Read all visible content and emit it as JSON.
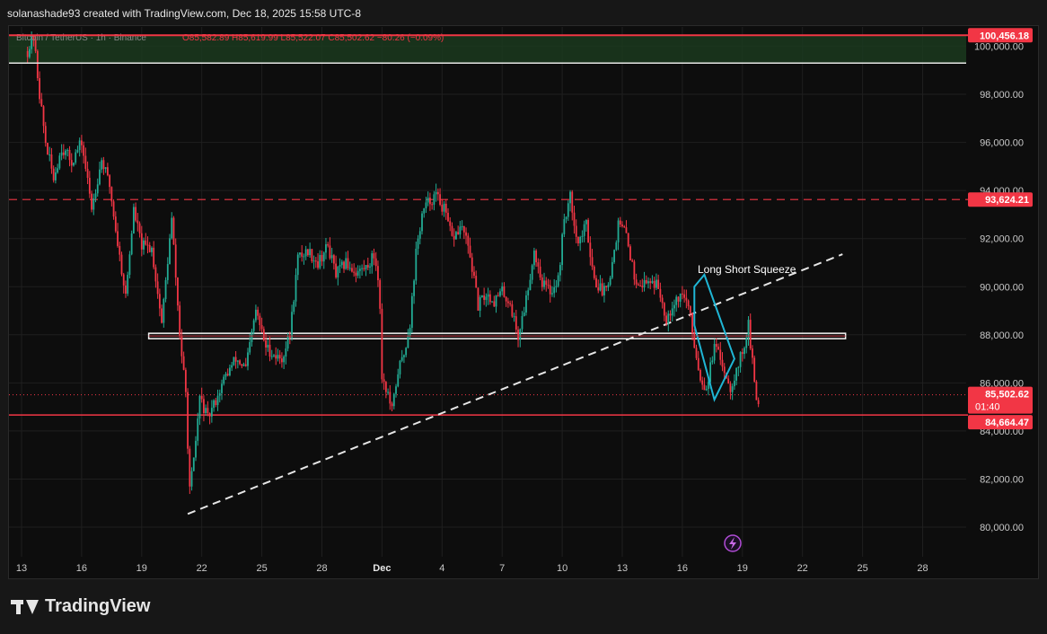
{
  "header": {
    "created_by": "solanashade93 created with TradingView.com, Dec 18, 2025 15:58 UTC-8"
  },
  "legend": {
    "symbol": "Bitcoin / TetherUS · 1h · Binance",
    "ohlc": "O85,582.89 H85,619.99 L85,522.07 C85,502.62 −80.26 (−0.09%)"
  },
  "footer": {
    "brand": "TradingView"
  },
  "chart_data": {
    "type": "candlestick",
    "x_ticks": [
      "13",
      "16",
      "19",
      "22",
      "25",
      "28",
      "Dec",
      "4",
      "7",
      "10",
      "13",
      "16",
      "19",
      "22",
      "25",
      "28"
    ],
    "y_ticks": [
      "80,000.00",
      "82,000.00",
      "84,000.00",
      "86,000.00",
      "88,000.00",
      "90,000.00",
      "92,000.00",
      "94,000.00",
      "96,000.00",
      "98,000.00",
      "100,000.00"
    ],
    "ylim": [
      79000,
      100600
    ],
    "grid": true,
    "price_path": [
      {
        "d": 13.3,
        "p": 99800
      },
      {
        "d": 13.6,
        "p": 100400
      },
      {
        "d": 13.9,
        "p": 98000
      },
      {
        "d": 14.2,
        "p": 96000
      },
      {
        "d": 14.6,
        "p": 94500
      },
      {
        "d": 15.0,
        "p": 95800
      },
      {
        "d": 15.5,
        "p": 95200
      },
      {
        "d": 16.0,
        "p": 96000
      },
      {
        "d": 16.5,
        "p": 93300
      },
      {
        "d": 17.0,
        "p": 95300
      },
      {
        "d": 17.4,
        "p": 94200
      },
      {
        "d": 17.8,
        "p": 91800
      },
      {
        "d": 18.2,
        "p": 89600
      },
      {
        "d": 18.6,
        "p": 93200
      },
      {
        "d": 19.0,
        "p": 91700
      },
      {
        "d": 19.5,
        "p": 91600
      },
      {
        "d": 20.0,
        "p": 88500
      },
      {
        "d": 20.5,
        "p": 92800
      },
      {
        "d": 20.9,
        "p": 88000
      },
      {
        "d": 21.2,
        "p": 85500
      },
      {
        "d": 21.4,
        "p": 81500
      },
      {
        "d": 21.6,
        "p": 82700
      },
      {
        "d": 21.9,
        "p": 85400
      },
      {
        "d": 22.3,
        "p": 84500
      },
      {
        "d": 22.7,
        "p": 85300
      },
      {
        "d": 23.2,
        "p": 86300
      },
      {
        "d": 23.7,
        "p": 87000
      },
      {
        "d": 24.2,
        "p": 86600
      },
      {
        "d": 24.7,
        "p": 89000
      },
      {
        "d": 25.2,
        "p": 87500
      },
      {
        "d": 25.7,
        "p": 87100
      },
      {
        "d": 26.0,
        "p": 87000
      },
      {
        "d": 26.4,
        "p": 88000
      },
      {
        "d": 26.8,
        "p": 91200
      },
      {
        "d": 27.3,
        "p": 91500
      },
      {
        "d": 27.8,
        "p": 91000
      },
      {
        "d": 28.3,
        "p": 91700
      },
      {
        "d": 28.7,
        "p": 90500
      },
      {
        "d": 29.2,
        "p": 91000
      },
      {
        "d": 29.7,
        "p": 90600
      },
      {
        "d": 30.2,
        "p": 90800
      },
      {
        "d": 30.6,
        "p": 91300
      },
      {
        "d": 30.85,
        "p": 90300
      },
      {
        "d": 31.0,
        "p": 86300
      },
      {
        "d": 31.3,
        "p": 85500
      },
      {
        "d": 31.5,
        "p": 84800
      },
      {
        "d": 31.8,
        "p": 86500
      },
      {
        "d": 32.1,
        "p": 87200
      },
      {
        "d": 32.4,
        "p": 88500
      },
      {
        "d": 32.7,
        "p": 91400
      },
      {
        "d": 33.0,
        "p": 93000
      },
      {
        "d": 33.3,
        "p": 93500
      },
      {
        "d": 33.7,
        "p": 93800
      },
      {
        "d": 34.1,
        "p": 93200
      },
      {
        "d": 34.5,
        "p": 92000
      },
      {
        "d": 35.0,
        "p": 92500
      },
      {
        "d": 35.4,
        "p": 91300
      },
      {
        "d": 35.8,
        "p": 89200
      },
      {
        "d": 36.2,
        "p": 89700
      },
      {
        "d": 36.6,
        "p": 89400
      },
      {
        "d": 37.0,
        "p": 89800
      },
      {
        "d": 37.4,
        "p": 89300
      },
      {
        "d": 37.8,
        "p": 87900
      },
      {
        "d": 38.2,
        "p": 89500
      },
      {
        "d": 38.6,
        "p": 91500
      },
      {
        "d": 39.0,
        "p": 90200
      },
      {
        "d": 39.4,
        "p": 89800
      },
      {
        "d": 39.8,
        "p": 90300
      },
      {
        "d": 40.1,
        "p": 92800
      },
      {
        "d": 40.4,
        "p": 93700
      },
      {
        "d": 40.8,
        "p": 91800
      },
      {
        "d": 41.2,
        "p": 92600
      },
      {
        "d": 41.6,
        "p": 90300
      },
      {
        "d": 42.0,
        "p": 89800
      },
      {
        "d": 42.4,
        "p": 90500
      },
      {
        "d": 42.8,
        "p": 92600
      },
      {
        "d": 43.2,
        "p": 92200
      },
      {
        "d": 43.6,
        "p": 90400
      },
      {
        "d": 44.0,
        "p": 90100
      },
      {
        "d": 44.4,
        "p": 90300
      },
      {
        "d": 44.8,
        "p": 90000
      },
      {
        "d": 45.2,
        "p": 88700
      },
      {
        "d": 45.6,
        "p": 89400
      },
      {
        "d": 46.0,
        "p": 89700
      },
      {
        "d": 46.3,
        "p": 89200
      },
      {
        "d": 46.6,
        "p": 87600
      },
      {
        "d": 46.9,
        "p": 86200
      },
      {
        "d": 47.2,
        "p": 85800
      },
      {
        "d": 47.6,
        "p": 87500
      },
      {
        "d": 48.0,
        "p": 86800
      },
      {
        "d": 48.4,
        "p": 85800
      },
      {
        "d": 48.8,
        "p": 86800
      },
      {
        "d": 49.1,
        "p": 87600
      },
      {
        "d": 49.3,
        "p": 88400
      },
      {
        "d": 49.6,
        "p": 86000
      },
      {
        "d": 49.75,
        "p": 85000
      },
      {
        "d": 49.85,
        "p": 85500
      }
    ],
    "annotations": {
      "top_zone_label": "100,456.18",
      "dashed_level_label": "93,624.21",
      "current_price_label": "85,502.62",
      "countdown": "01:40",
      "support_label": "84,664.47",
      "squeeze_text": "Long Short Squeeze"
    },
    "levels": {
      "top_zone_high": 100456.18,
      "top_zone_low": 99300,
      "dashed_level": 93624.21,
      "box_level": 87950,
      "current_price": 85502.62,
      "support": 84664.47,
      "trendline_start": {
        "d": 21.3,
        "p": 80550
      },
      "trendline_end": {
        "d": 54.0,
        "p": 91350
      },
      "squeeze_polygon": [
        {
          "d": 46.6,
          "p": 90000
        },
        {
          "d": 47.1,
          "p": 90500
        },
        {
          "d": 48.6,
          "p": 87000
        },
        {
          "d": 47.6,
          "p": 85300
        },
        {
          "d": 46.6,
          "p": 88400
        }
      ],
      "box_start_d": 19.35,
      "box_end_d": 54.15
    },
    "colors": {
      "up": "#22ab94",
      "down": "#f23645",
      "level_line": "#f23645",
      "tag_bg": "#f23645",
      "squeeze": "#1fb6d5",
      "trendline": "#e6e6e6"
    }
  }
}
